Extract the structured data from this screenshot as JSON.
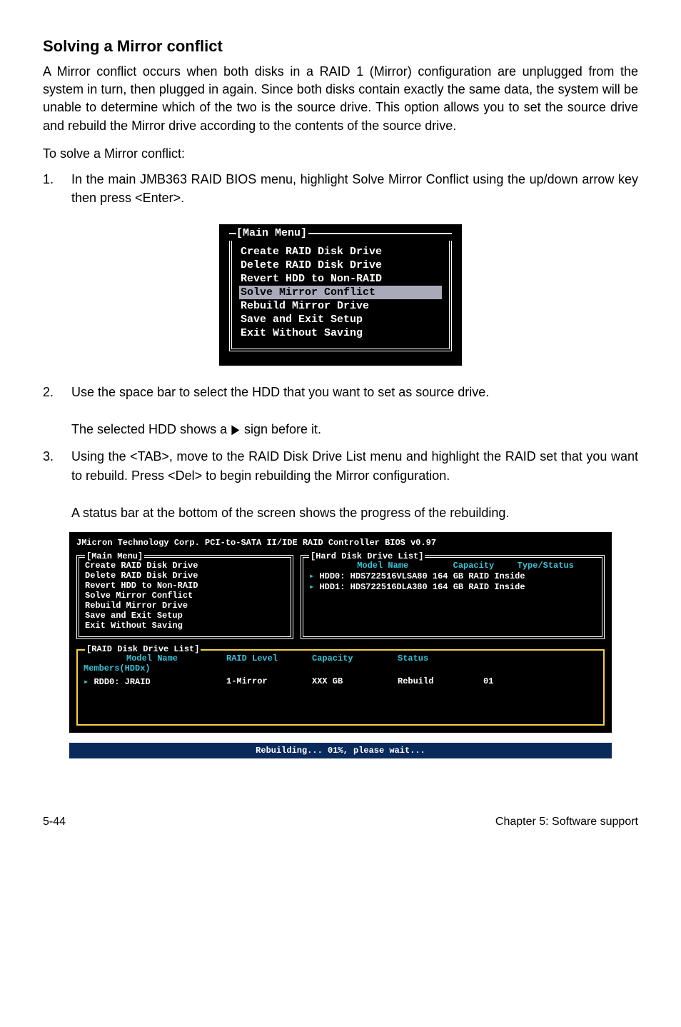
{
  "heading": "Solving a Mirror conflict",
  "para1": "A Mirror conflict occurs when both disks in a RAID 1 (Mirror) configuration are unplugged from the system in turn, then plugged in again. Since both disks contain exactly the same data, the system will be unable to determine which of the two is the source drive. This option allows you to set the source drive and rebuild the Mirror drive according to the contents of the source drive.",
  "para2": "To solve a Mirror conflict:",
  "step1_num": "1.",
  "step1_text": "In the main JMB363 RAID BIOS menu, highlight Solve Mirror Conflict using the up/down arrow key then press <Enter>.",
  "menu": {
    "title": "[Main Menu]",
    "items": [
      "Create RAID Disk Drive",
      "Delete RAID Disk Drive",
      "Revert HDD to Non-RAID",
      "Solve Mirror Conflict",
      "Rebuild Mirror Drive",
      "Save and Exit Setup",
      "Exit Without Saving"
    ],
    "highlight_index": 3
  },
  "step2_num": "2.",
  "step2_text": "Use the space bar to select the HDD that you want to set as source drive.",
  "step2_sub_before": "The selected HDD shows a ",
  "step2_sub_after": " sign before it.",
  "step3_num": "3.",
  "step3_text": "Using the <TAB>, move to the RAID Disk Drive List menu and highlight the RAID set that you want to rebuild. Press <Del> to begin rebuilding the Mirror configuration.",
  "step3_sub": "A status bar at the bottom of the screen shows the progress of the rebuilding.",
  "big": {
    "title": "JMicron Technology Corp. PCI-to-SATA II/IDE RAID Controller BIOS v0.97",
    "main_label": "[Main Menu]",
    "main_items": [
      "Create RAID Disk Drive",
      "Delete RAID Disk Drive",
      "Revert HDD to Non-RAID",
      "Solve Mirror Conflict",
      "Rebuild Mirror Drive",
      "Save and Exit Setup",
      "Exit Without Saving"
    ],
    "hard_label": "[Hard Disk Drive List]",
    "hard_header": {
      "model": "Model Name",
      "capacity": "Capacity",
      "type": "Type/Status"
    },
    "hard_rows": [
      {
        "id": "HDD0:",
        "model": "HDS722516VLSA80",
        "cap": "164 GB",
        "type": "RAID Inside"
      },
      {
        "id": "HDD1:",
        "model": "HDS722516DLA380",
        "cap": "164 GB",
        "type": "RAID Inside"
      }
    ],
    "raid_label": "[RAID Disk Drive List]",
    "raid_header": {
      "model": "Model Name",
      "level": "RAID Level",
      "cap": "Capacity",
      "status": "Status"
    },
    "raid_members": "Members(HDDx)",
    "raid_row": {
      "id": "RDD0:",
      "name": "JRAID",
      "level": "1-Mirror",
      "cap": "XXX GB",
      "status": "Rebuild",
      "extra": "01"
    },
    "rebuild": "Rebuilding... 01%, please wait..."
  },
  "footer_left": "5-44",
  "footer_right": "Chapter 5: Software support"
}
